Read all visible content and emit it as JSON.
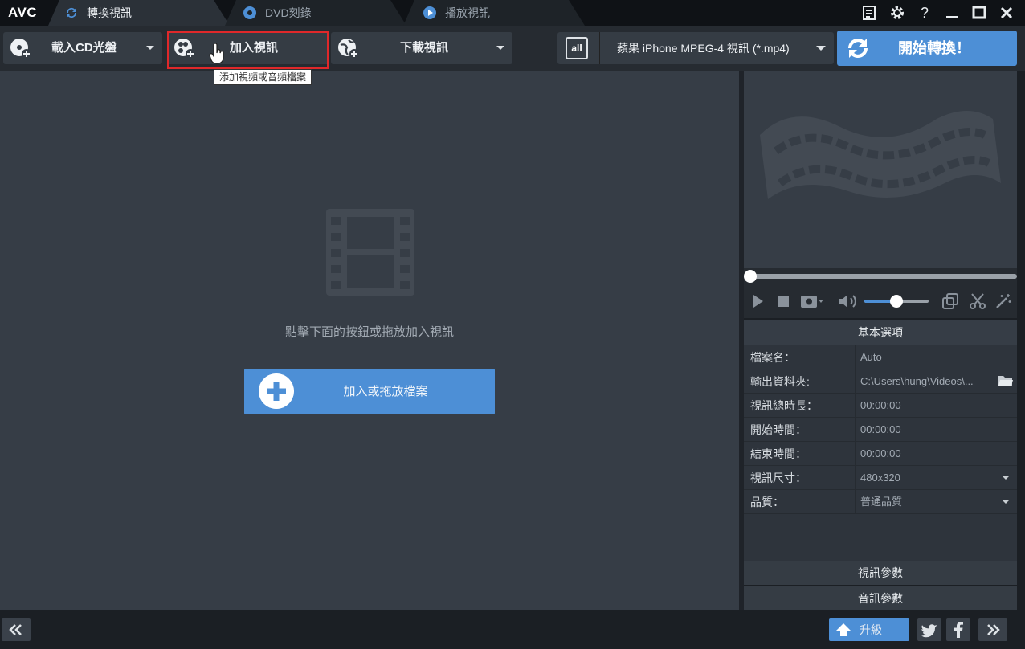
{
  "app": {
    "logo": "AVC"
  },
  "tabs": [
    {
      "label": "轉換視訊",
      "active": true
    },
    {
      "label": "DVD刻錄",
      "active": false
    },
    {
      "label": "播放視訊",
      "active": false
    }
  ],
  "window_controls": {
    "help": "?"
  },
  "toolbar": {
    "import_cd_label": "載入CD光盤",
    "add_video_label": "加入視訊",
    "download_video_label": "下載視訊",
    "format_icon_text": "all",
    "format_label": "蘋果 iPhone MPEG-4 視訊 (*.mp4)",
    "start_label": "開始轉換！",
    "tooltip": "添加視頻或音頻檔案"
  },
  "main": {
    "hint": "點擊下面的按鈕或拖放加入視訊",
    "add_file_label": "加入或拖放檔案"
  },
  "props": {
    "title": "基本選項",
    "rows": [
      {
        "key": "檔案名：",
        "value": "Auto"
      },
      {
        "key": "輸出資料夾:",
        "value": "C:\\Users\\hung\\Videos\\..."
      },
      {
        "key": "視訊總時長：",
        "value": "00:00:00"
      },
      {
        "key": "開始時間：",
        "value": "00:00:00"
      },
      {
        "key": "結束時間：",
        "value": "00:00:00"
      },
      {
        "key": "視訊尺寸：",
        "value": "480x320"
      },
      {
        "key": "品質：",
        "value": "普通品質"
      }
    ],
    "video_params": "視訊參數",
    "audio_params": "音訊參數"
  },
  "player": {
    "volume": 0.5,
    "seek": 0
  },
  "bottom": {
    "upgrade_label": "升級"
  },
  "colors": {
    "accent": "#4d8fd6",
    "highlight": "#e0282a"
  }
}
